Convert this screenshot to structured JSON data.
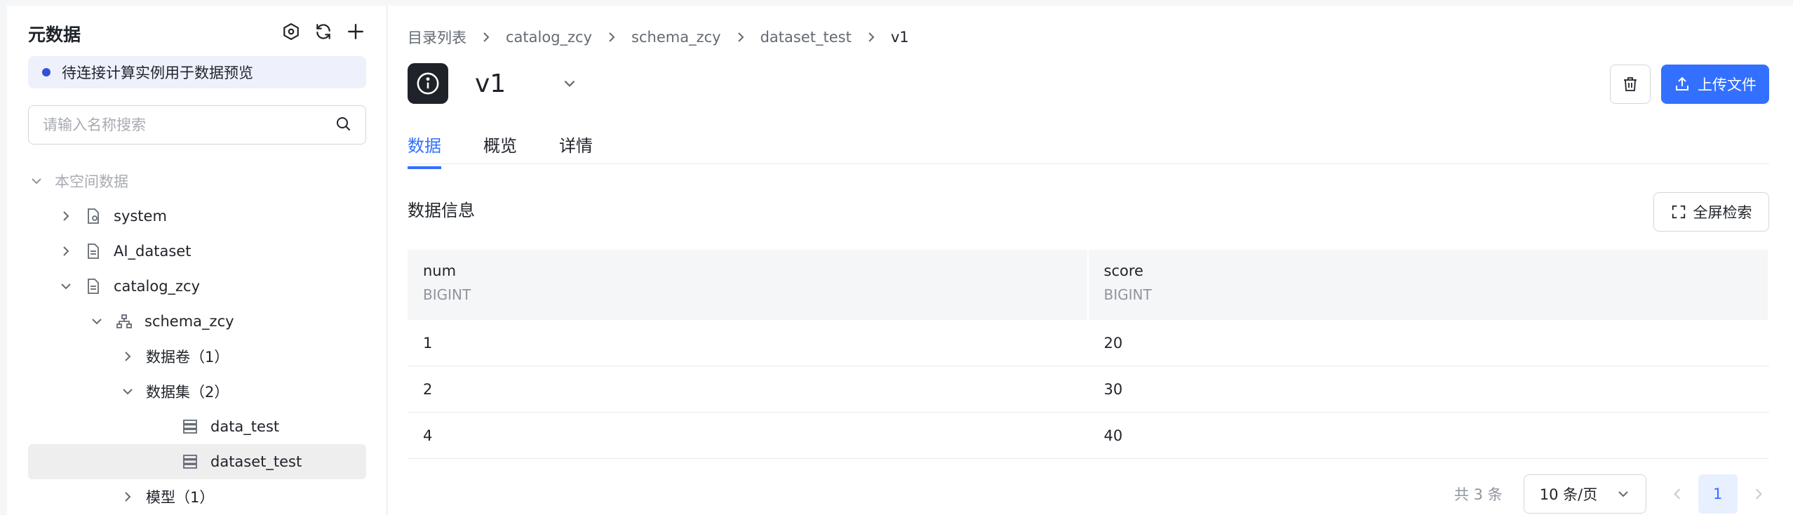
{
  "sidebar": {
    "title": "元数据",
    "notice": "待连接计算实例用于数据预览",
    "search_placeholder": "请输入名称搜索",
    "tree": [
      {
        "label": "本空间数据",
        "muted": true
      },
      {
        "label": "system"
      },
      {
        "label": "AI_dataset"
      },
      {
        "label": "catalog_zcy"
      },
      {
        "label": "schema_zcy"
      },
      {
        "label": "数据卷（1）"
      },
      {
        "label": "数据集（2）"
      },
      {
        "label": "data_test"
      },
      {
        "label": "dataset_test"
      },
      {
        "label": "模型（1）"
      }
    ]
  },
  "breadcrumb": [
    "目录列表",
    "catalog_zcy",
    "schema_zcy",
    "dataset_test",
    "v1"
  ],
  "dataset": {
    "title": "v1",
    "upload_label": "上传文件"
  },
  "tabs": [
    "数据",
    "概览",
    "详情"
  ],
  "section": {
    "title": "数据信息",
    "fullscreen_label": "全屏检索"
  },
  "table": {
    "columns": [
      {
        "name": "num",
        "type": "BIGINT"
      },
      {
        "name": "score",
        "type": "BIGINT"
      }
    ],
    "rows": [
      [
        "1",
        "20"
      ],
      [
        "2",
        "30"
      ],
      [
        "4",
        "40"
      ]
    ]
  },
  "pagination": {
    "total": "共 3 条",
    "page_size": "10 条/页",
    "current_page": "1"
  },
  "colors": {
    "accent": "#3370ff",
    "notice_dot": "#3451d6"
  }
}
